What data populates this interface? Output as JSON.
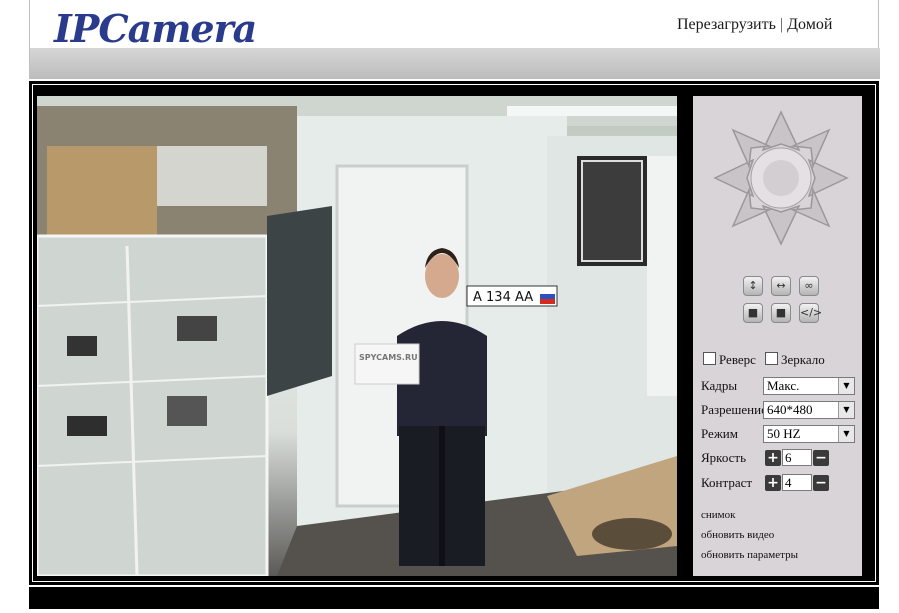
{
  "header": {
    "logo_text": "IPCamera",
    "reboot_link": "Перезагрузить",
    "separator": "|",
    "home_link": "Домой"
  },
  "video": {
    "plate_text": "A 134 AA",
    "sign_text": "SPYCAMS.RU"
  },
  "panel": {
    "ptz_icon": "ptz-direction-pad-icon",
    "buttons_row1": [
      "↕",
      "↔",
      "∞"
    ],
    "buttons_row2": [
      "■",
      "■",
      "</>"
    ],
    "reverse_label": "Реверс",
    "mirror_label": "Зеркало",
    "frames_label": "Кадры",
    "frames_value": "Макс.",
    "resolution_label": "Разрешение",
    "resolution_value": "640*480",
    "mode_label": "Режим",
    "mode_value": "50 HZ",
    "brightness_label": "Яркость",
    "brightness_value": "6",
    "contrast_label": "Контраст",
    "contrast_value": "4",
    "snapshot_link": "снимок",
    "refresh_video_link": "обновить видео",
    "refresh_params_link": "обновить параметры",
    "plus": "+",
    "minus": "−",
    "arrow": "▼"
  }
}
